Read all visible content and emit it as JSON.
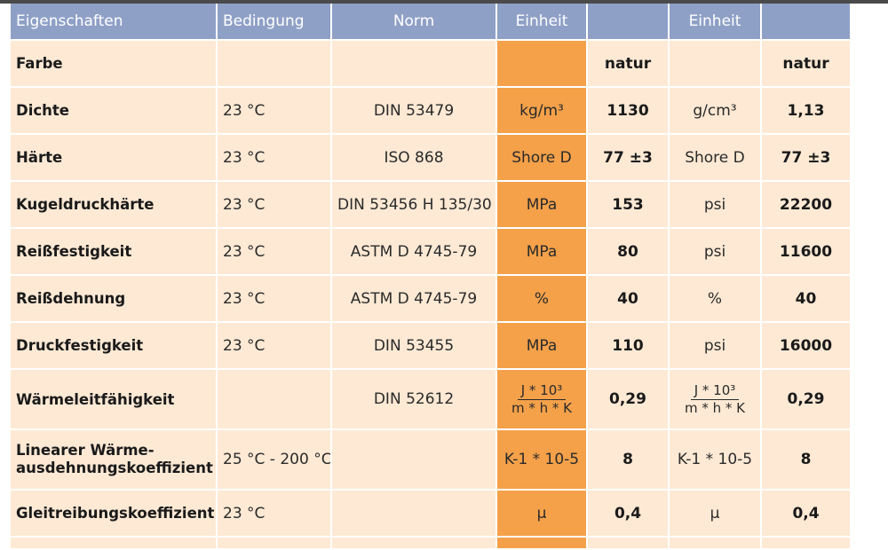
{
  "header": {
    "eigenschaften": "Eigenschaften",
    "bedingung": "Bedingung",
    "norm": "Norm",
    "einheit1": "Einheit",
    "value1": "",
    "einheit2": "Einheit",
    "value2": ""
  },
  "rows": [
    {
      "prop": "Farbe",
      "cond": "",
      "norm": "",
      "unit1": "",
      "val1": "natur",
      "unit2": "",
      "val2": "natur"
    },
    {
      "prop": "Dichte",
      "cond": "23 °C",
      "norm": "DIN 53479",
      "unit1": "kg/m³",
      "val1": "1130",
      "unit2": "g/cm³",
      "val2": "1,13"
    },
    {
      "prop": "Härte",
      "cond": "23 °C",
      "norm": "ISO 868",
      "unit1": "Shore D",
      "val1": "77 ±3",
      "unit2": "Shore D",
      "val2": "77 ±3"
    },
    {
      "prop": "Kugeldruckhärte",
      "cond": "23 °C",
      "norm": "DIN 53456 H 135/30",
      "unit1": "MPa",
      "val1": "153",
      "unit2": "psi",
      "val2": "22200"
    },
    {
      "prop": "Reißfestigkeit",
      "cond": "23 °C",
      "norm": "ASTM D 4745-79",
      "unit1": "MPa",
      "val1": "80",
      "unit2": "psi",
      "val2": "11600"
    },
    {
      "prop": "Reißdehnung",
      "cond": "23 °C",
      "norm": "ASTM D 4745-79",
      "unit1": "%",
      "val1": "40",
      "unit2": "%",
      "val2": "40"
    },
    {
      "prop": "Druckfestigkeit",
      "cond": "23 °C",
      "norm": "DIN 53455",
      "unit1": "MPa",
      "val1": "110",
      "unit2": "psi",
      "val2": "16000"
    },
    {
      "prop": "Wärmeleitfähigkeit",
      "cond": "",
      "norm": "DIN 52612",
      "unit1_num": "J * 10³",
      "unit1_den": "m * h * K",
      "val1": "0,29",
      "unit2_num": "J * 10³",
      "unit2_den": "m * h * K",
      "val2": "0,29"
    },
    {
      "prop_line1": "Linearer Wärme-",
      "prop_line2": "ausdehnungskoeffizient",
      "cond": "25 °C - 200 °C",
      "norm": "",
      "unit1": "K-1 * 10-5",
      "val1": "8",
      "unit2": "K-1 * 10-5",
      "val2": "8"
    },
    {
      "prop": "Gleitreibungskoeffizient *",
      "cond": "23 °C",
      "norm": "",
      "unit1": "μ",
      "val1": "0,4",
      "unit2": "μ",
      "val2": "0,4"
    }
  ],
  "colors": {
    "header_bg": "#8fa0c6",
    "row_bg": "#fde9d4",
    "highlight_bg": "#f4a14a"
  }
}
